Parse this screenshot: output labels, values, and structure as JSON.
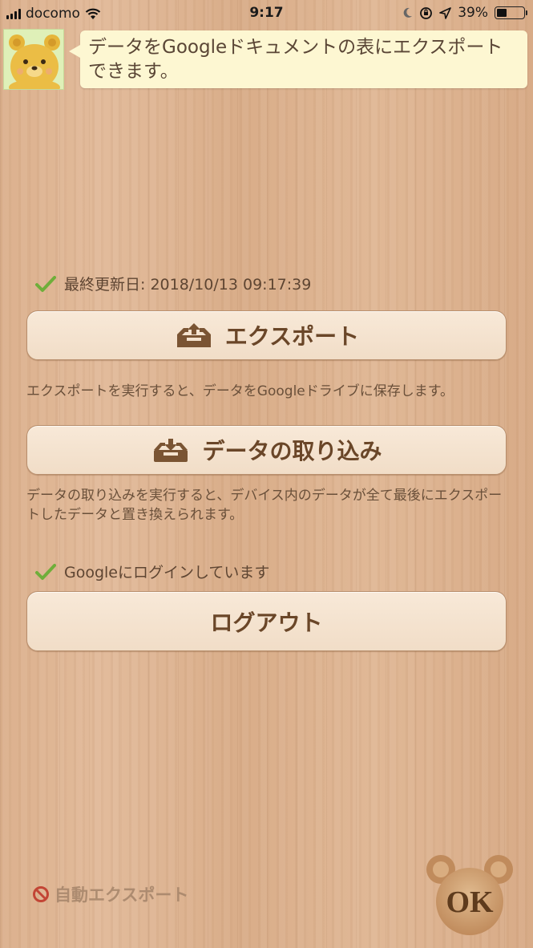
{
  "status_bar": {
    "carrier": "docomo",
    "time": "9:17",
    "battery": "39%"
  },
  "header": {
    "message": "データをGoogleドキュメントの表にエクスポートできます。"
  },
  "last_updated": {
    "label": "最終更新日: 2018/10/13 09:17:39"
  },
  "export": {
    "button_label": "エクスポート",
    "description": "エクスポートを実行すると、データをGoogleドライブに保存します。"
  },
  "import": {
    "button_label": "データの取り込み",
    "description": "データの取り込みを実行すると、デバイス内のデータが全て最後にエクスポートしたデータと置き換えられます。"
  },
  "login": {
    "status": "Googleにログインしています",
    "logout_label": "ログアウト"
  },
  "auto_export": {
    "label": "自動エクスポート"
  },
  "ok_button": {
    "label": "OK"
  },
  "colors": {
    "accent_brown": "#6a4628",
    "check_green": "#6fae3a",
    "disabled_red": "#c0392b"
  }
}
